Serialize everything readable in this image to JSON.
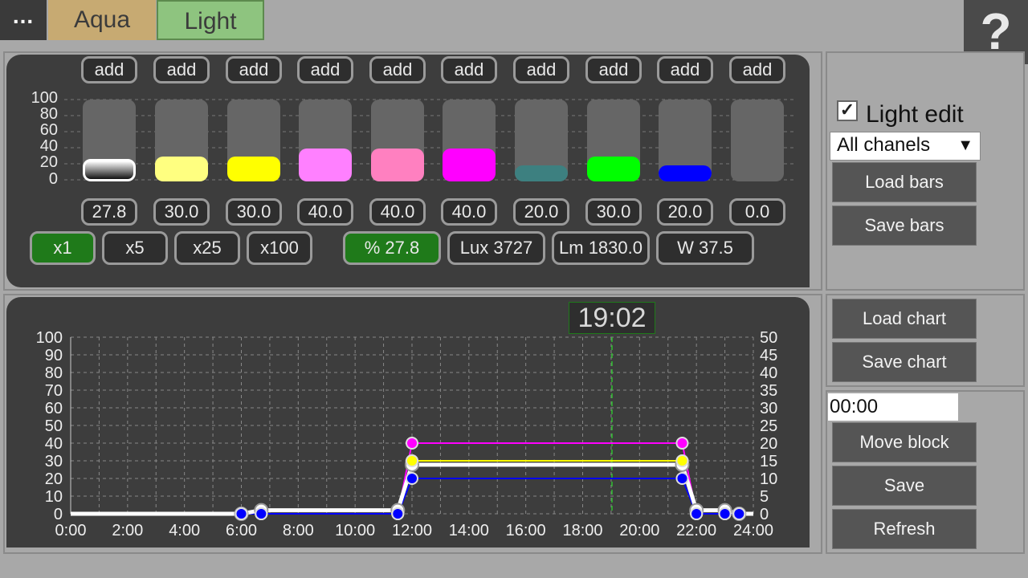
{
  "topbar": {
    "menu_label": "...",
    "tabs": [
      "Aqua",
      "Light"
    ],
    "help_label": "?"
  },
  "bars": {
    "add_label": "add",
    "axis_ticks": [
      "100",
      "80",
      "60",
      "40",
      "20",
      "0"
    ],
    "channels": [
      {
        "value_label": "27.8",
        "level": 27.8,
        "color": "#ffffff"
      },
      {
        "value_label": "30.0",
        "level": 30.0,
        "color": "#ffff80"
      },
      {
        "value_label": "30.0",
        "level": 30.0,
        "color": "#ffff00"
      },
      {
        "value_label": "40.0",
        "level": 40.0,
        "color": "#ff80ff"
      },
      {
        "value_label": "40.0",
        "level": 40.0,
        "color": "#ff80c0"
      },
      {
        "value_label": "40.0",
        "level": 40.0,
        "color": "#ff00ff"
      },
      {
        "value_label": "20.0",
        "level": 20.0,
        "color": "#3d8080"
      },
      {
        "value_label": "30.0",
        "level": 30.0,
        "color": "#00ff00"
      },
      {
        "value_label": "20.0",
        "level": 20.0,
        "color": "#0000ff"
      },
      {
        "value_label": "0.0",
        "level": 0.0,
        "color": "#666666"
      }
    ],
    "multipliers": [
      "x1",
      "x5",
      "x25",
      "x100"
    ],
    "stats": [
      "% 27.8",
      "Lux 3727",
      "Lm 1830.0",
      "W 37.5"
    ]
  },
  "side": {
    "light_edit_label": "Light edit",
    "light_edit_checked": true,
    "chanel_select": "All chanels",
    "load_bars": "Load bars",
    "save_bars": "Save bars",
    "load_chart": "Load chart",
    "save_chart": "Save chart",
    "time_value": "00:00",
    "move_block": "Move block",
    "save": "Save",
    "refresh": "Refresh"
  },
  "chart": {
    "current_time": "19:02",
    "left_ticks": [
      "100",
      "90",
      "80",
      "70",
      "60",
      "50",
      "40",
      "30",
      "20",
      "10",
      "0"
    ],
    "right_ticks": [
      "50",
      "45",
      "40",
      "35",
      "30",
      "25",
      "20",
      "15",
      "10",
      "5",
      "0"
    ],
    "x_ticks": [
      "0:00",
      "2:00",
      "4:00",
      "6:00",
      "8:00",
      "10:00",
      "12:00",
      "14:00",
      "16:00",
      "18:00",
      "20:00",
      "22:00",
      "24:00"
    ]
  },
  "chart_data": {
    "type": "line",
    "x_unit": "hours",
    "xlim": [
      0,
      24
    ],
    "ylim": [
      0,
      100
    ],
    "ylim_right": [
      0,
      50
    ],
    "grid": true,
    "current_time_hours": 19.03,
    "series": [
      {
        "color": "#ff00ff",
        "x": [
          0,
          6,
          6.7,
          11.5,
          12,
          21.5,
          22,
          23,
          23.5,
          24
        ],
        "y": [
          0,
          0,
          0,
          0,
          40,
          40,
          0,
          0,
          0,
          0
        ]
      },
      {
        "color": "#00ff00",
        "x": [
          0,
          6,
          6.7,
          11.5,
          12,
          21.5,
          22,
          23,
          23.5,
          24
        ],
        "y": [
          0,
          0,
          0,
          0,
          30,
          30,
          0,
          0,
          0,
          0
        ]
      },
      {
        "color": "#ffff00",
        "x": [
          0,
          6,
          6.7,
          11.5,
          12,
          21.5,
          22,
          23,
          23.5,
          24
        ],
        "y": [
          0,
          0,
          0,
          0,
          30,
          30,
          0,
          0,
          0,
          0
        ]
      },
      {
        "color": "#0000ff",
        "x": [
          0,
          6,
          6.7,
          11.5,
          12,
          21.5,
          22,
          23,
          23.5,
          24
        ],
        "y": [
          0,
          0,
          0,
          0,
          20,
          20,
          0,
          0,
          0,
          0
        ]
      },
      {
        "color": "#ffffff",
        "x": [
          0,
          6,
          6.7,
          11.5,
          12,
          21.5,
          22,
          23,
          23.5,
          24
        ],
        "y": [
          0,
          0,
          2,
          2,
          27.8,
          27.8,
          2,
          2,
          0,
          0
        ]
      }
    ]
  }
}
